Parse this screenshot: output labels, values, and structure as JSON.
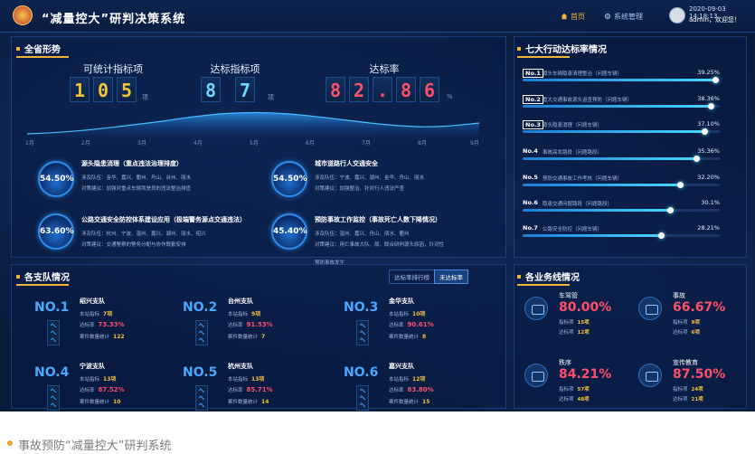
{
  "header": {
    "title": "“减量控大”研判决策系统",
    "nav": [
      {
        "label": "首页",
        "icon": "home-icon"
      },
      {
        "label": "系统管理",
        "icon": "gear-icon"
      }
    ],
    "datetime": "2020-09-03 14:18:13",
    "user": "admin，欢迎您！"
  },
  "overview": {
    "title": "全省形势",
    "counters": [
      {
        "label": "可统计指标项",
        "digits": [
          "1",
          "0",
          "5"
        ],
        "unit": "项",
        "color": "#f3c13a"
      },
      {
        "label": "达标指标项",
        "digits": [
          "8",
          "7"
        ],
        "unit": "项",
        "color": "#6fd8ff"
      },
      {
        "label": "达标率",
        "digits": [
          "8",
          "2",
          ".",
          "8",
          "6"
        ],
        "unit": "%",
        "color": "#ff4f6a"
      }
    ],
    "axis_ticks": [
      "1月",
      "2月",
      "3月",
      "4月",
      "5月",
      "6月",
      "7月",
      "8月",
      "9月"
    ],
    "items": [
      {
        "pct": "54.50%",
        "title": "源头隐患消理（重点违法治理排度）",
        "l1": "涉及队伍：金华、嘉兴、衢州、舟山、台州、丽水",
        "l2": "对策建议：加强对重点车辆驾驶员的违法整治排查"
      },
      {
        "pct": "54.50%",
        "title": "城市道路行人交通安全",
        "l1": "涉及队伍：宁波、嘉兴、湖州、金华、舟山、丽水",
        "l2": "对策建议：加强整治、针对行人违法严查"
      },
      {
        "pct": "63.60%",
        "title": "公路交通安全防控体系建设应用（极端警务源点交通违法）",
        "l1": "涉及队伍：杭州、宁波、温州、嘉兴、湖州、丽水、绍兴",
        "l2": "对策建议：交通警察的警务分配与协作联勤安排"
      },
      {
        "pct": "45.40%",
        "title": "预防事故工作监控（事故死亡人数下降情况）",
        "l1": "涉及队伍：温州、嘉兴、舟山、丽水、衢州",
        "l2": "对策建议：用亡事故大队、局、联合研判源头原因，针对性",
        "l3": "预防事故发生"
      }
    ]
  },
  "ranking": {
    "title": "七大行动达标率情况",
    "rows": [
      {
        "no": "No.1",
        "boxed": true,
        "desc": "源头车辆隐患清理整治（问题车辆）",
        "pct": "39.25%",
        "value": 39.25
      },
      {
        "no": "No.2",
        "boxed": true,
        "desc": "重大交通事故源头追查预防（问题车辆）",
        "pct": "38.36%",
        "value": 38.36
      },
      {
        "no": "No.3",
        "boxed": true,
        "desc": "源头隐患消理（问题车辆）",
        "pct": "37.10%",
        "value": 37.1
      },
      {
        "no": "No.4",
        "boxed": false,
        "desc": "事故高发路段（问题路段）",
        "pct": "35.36%",
        "value": 35.36
      },
      {
        "no": "No.5",
        "boxed": false,
        "desc": "预防交通事故工作考核（问题车辆）",
        "pct": "32.20%",
        "value": 32.2
      },
      {
        "no": "No.6",
        "boxed": false,
        "desc": "隐患交通问题路段（问题路段）",
        "pct": "30.1%",
        "value": 30.1
      },
      {
        "no": "No.7",
        "boxed": false,
        "desc": "公路安全防控（问题车辆）",
        "pct": "28.21%",
        "value": 28.21
      }
    ]
  },
  "teams": {
    "title": "各支队情况",
    "buttons": [
      {
        "label": "达标率排行榜",
        "active": false
      },
      {
        "label": "未达标率",
        "active": true
      }
    ],
    "list": [
      {
        "rank": "NO.1",
        "name": "绍兴支队",
        "l1k": "本站指标",
        "l1v": "7项",
        "l2k": "达标率",
        "l2v": "73.33%",
        "l3k": "案件数量统计",
        "l3v": "122"
      },
      {
        "rank": "NO.2",
        "name": "台州支队",
        "l1k": "本站指标",
        "l1v": "9项",
        "l2k": "达标率",
        "l2v": "91.53%",
        "l3k": "案件数量统计",
        "l3v": "7"
      },
      {
        "rank": "NO.3",
        "name": "金华支队",
        "l1k": "本站指标",
        "l1v": "10项",
        "l2k": "达标率",
        "l2v": "90.61%",
        "l3k": "案件数量统计",
        "l3v": "8"
      },
      {
        "rank": "NO.4",
        "name": "宁波支队",
        "l1k": "本站指标",
        "l1v": "13项",
        "l2k": "达标率",
        "l2v": "87.52%",
        "l3k": "案件数量统计",
        "l3v": "10"
      },
      {
        "rank": "NO.5",
        "name": "杭州支队",
        "l1k": "本站指标",
        "l1v": "13项",
        "l2k": "达标率",
        "l2v": "85.71%",
        "l3k": "案件数量统计",
        "l3v": "14"
      },
      {
        "rank": "NO.6",
        "name": "嘉兴支队",
        "l1k": "本站指标",
        "l1v": "12项",
        "l2k": "达标率",
        "l2v": "83.80%",
        "l3k": "案件数量统计",
        "l3v": "15"
      }
    ]
  },
  "industry": {
    "title": "各业务线情况",
    "list": [
      {
        "name": "车驾管",
        "pct": "80.00%",
        "color": "#ff4f6a",
        "l1k": "指标项",
        "l1v": "15项",
        "l2k": "达标项",
        "l2v": "12项"
      },
      {
        "name": "事故",
        "pct": "66.67%",
        "color": "#ff4f6a",
        "l1k": "指标项",
        "l1v": "9项",
        "l2k": "达标项",
        "l2v": "6项"
      },
      {
        "name": "秩序",
        "pct": "84.21%",
        "color": "#ff4f6a",
        "l1k": "指标项",
        "l1v": "57项",
        "l2k": "达标项",
        "l2v": "48项"
      },
      {
        "name": "宣传教育",
        "pct": "87.50%",
        "color": "#ff4f6a",
        "l1k": "指标项",
        "l1v": "24项",
        "l2k": "达标项",
        "l2v": "21项"
      }
    ]
  },
  "caption": "事故预防“减量控大”研判系统"
}
